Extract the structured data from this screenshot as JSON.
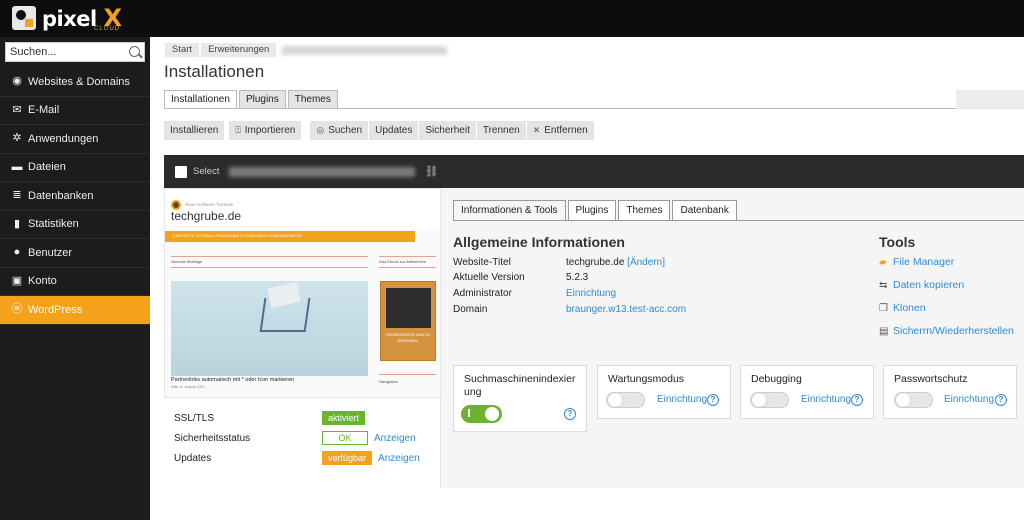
{
  "brand": {
    "name": "pixel",
    "x": "X",
    "sub": "CLOUD"
  },
  "sidebar": {
    "search_placeholder": "Suchen...",
    "items": [
      {
        "label": "Websites & Domains",
        "icon": "globe-icon"
      },
      {
        "label": "E-Mail",
        "icon": "mail-icon"
      },
      {
        "label": "Anwendungen",
        "icon": "gear-icon"
      },
      {
        "label": "Dateien",
        "icon": "folder-icon"
      },
      {
        "label": "Datenbanken",
        "icon": "database-icon"
      },
      {
        "label": "Statistiken",
        "icon": "bar-chart-icon"
      },
      {
        "label": "Benutzer",
        "icon": "user-icon"
      },
      {
        "label": "Konto",
        "icon": "id-card-icon"
      },
      {
        "label": "WordPress",
        "icon": "wordpress-icon"
      }
    ]
  },
  "breadcrumb": [
    "Start",
    "Erweiterungen"
  ],
  "page_title": "Installationen",
  "tabs": [
    "Installationen",
    "Plugins",
    "Themes"
  ],
  "toolbar": {
    "install": "Installieren",
    "import": "Importieren",
    "search": "Suchen",
    "updates": "Updates",
    "security": "Sicherheit",
    "detach": "Trennen",
    "remove": "Entfernen"
  },
  "select_label": "Select",
  "preview": {
    "tagline": "Neue Software Tutorials",
    "logo": "techgrube.de",
    "nav": "STARTSEITE    TUTORIALS    PROGRAMME & DOWNLOADS    SONDERANGEBOTE",
    "recent": "Neueste Beiträge",
    "post_title": "Partnerlinks automatisch mit * oder Icon markieren",
    "post_meta": "Mike    11. August 2023",
    "sidebar_head": "Das Ebook zur Artikelreihe",
    "book_title": "HOMESERVER-NAS IM EIGENBAU",
    "nav_head": "Navigation"
  },
  "status": [
    {
      "label": "SSL/TLS",
      "badge": "aktiviert",
      "link": ""
    },
    {
      "label": "Sicherheitsstatus",
      "badge": "OK",
      "link": "Anzeigen"
    },
    {
      "label": "Updates",
      "badge": "verfügbar",
      "link": "Anzeigen"
    }
  ],
  "inner_tabs": [
    "Informationen & Tools",
    "Plugins",
    "Themes",
    "Datenbank"
  ],
  "info": {
    "title": "Allgemeine Informationen",
    "rows": [
      {
        "label": "Website-Titel",
        "value": "techgrube.de",
        "link": "[Ändern]"
      },
      {
        "label": "Aktuelle Version",
        "value": "5.2.3",
        "link": ""
      },
      {
        "label": "Administrator",
        "value": "",
        "link": "Einrichtung"
      },
      {
        "label": "Domain",
        "value": "",
        "link": "braunger.w13.test-acc.com"
      }
    ]
  },
  "tools": {
    "title": "Tools",
    "items": [
      {
        "label": "File Manager",
        "icon": "folder-open-icon"
      },
      {
        "label": "Daten kopieren",
        "icon": "copy-data-icon"
      },
      {
        "label": "Klonen",
        "icon": "clone-icon"
      },
      {
        "label": "Sicherrn/Wiederherstellen",
        "icon": "backup-icon"
      }
    ]
  },
  "toggles": [
    {
      "title": "Suchmaschinenindexier ung",
      "state": "on",
      "link": ""
    },
    {
      "title": "Wartungsmodus",
      "state": "off",
      "link": "Einrichtung"
    },
    {
      "title": "Debugging",
      "state": "off",
      "link": "Einrichtung"
    },
    {
      "title": "Passwortschutz",
      "state": "off",
      "link": "Einrichtung"
    }
  ],
  "colors": {
    "accent": "#f5a21b",
    "green": "#6cb330",
    "link": "#2f8bd2",
    "dark": "#1c1c1c"
  }
}
